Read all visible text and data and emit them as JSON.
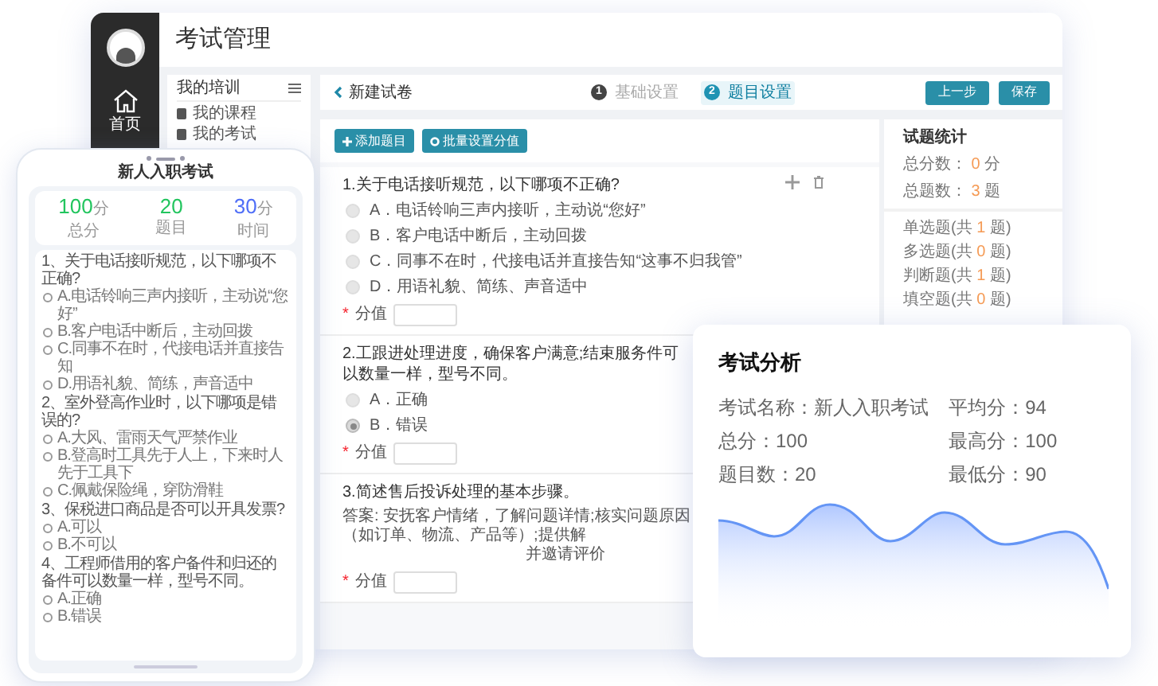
{
  "admin": {
    "title": "考试管理",
    "nav": [
      {
        "label": "首页",
        "selected": true
      }
    ],
    "sub_sidebar": {
      "title": "我的培训",
      "items": [
        {
          "label": "我的课程"
        },
        {
          "label": "我的考试"
        }
      ]
    },
    "topbar": {
      "back": "新建试卷",
      "steps": [
        {
          "number": "1",
          "label": "基础设置",
          "selected": false
        },
        {
          "number": "2",
          "label": "题目设置",
          "selected": true
        }
      ],
      "buttons": [
        "上一步",
        "保存"
      ]
    },
    "actions": [
      "添加题目",
      "批量设置分值"
    ],
    "questions": [
      {
        "kind": "choice",
        "title": "1.关于电话接听规范，以下哪项不正确?",
        "tools": true,
        "options": [
          {
            "label": "A．电话铃响三声内接听，主动说“您好”",
            "selected": false
          },
          {
            "label": "B．客户电话中断后，主动回拨",
            "selected": false
          },
          {
            "label": "C．同事不在时，代接电话并直接告知“这事不归我管”",
            "selected": false
          },
          {
            "label": "D．用语礼貌、简练、声音适中",
            "selected": false
          }
        ],
        "required": "*",
        "score_label": "分值"
      },
      {
        "kind": "choice",
        "title": "2.工跟进处理进度，确保客户满意;结束服务件可以数量一样，型号不同。",
        "options": [
          {
            "label": "A．正确",
            "selected": false
          },
          {
            "label": "B．错误",
            "selected": true
          }
        ],
        "required": "*",
        "score_label": "分值"
      },
      {
        "kind": "answer",
        "title": "3.简述售后投诉处理的基本步骤。",
        "answer": "答案: 安抚客户情绪，了解问题详情;核实问题原因（如订单、物流、产品等）;提供解",
        "answer_tail": "并邀请评价",
        "required": "*",
        "score_label": "分值"
      }
    ],
    "stats": {
      "title": "试题统计",
      "totals": [
        {
          "label": "总分数：",
          "value": "0",
          "unit": "分"
        },
        {
          "label": "总题数：",
          "value": "3",
          "unit": "题"
        }
      ],
      "types": [
        {
          "label": "单选题(共",
          "value": "1",
          "unit": "题)"
        },
        {
          "label": "多选题(共",
          "value": "0",
          "unit": "题)"
        },
        {
          "label": "判断题(共",
          "value": "1",
          "unit": "题)"
        },
        {
          "label": "填空题(共",
          "value": "0",
          "unit": "题)"
        }
      ]
    }
  },
  "phone": {
    "title": "新人入职考试",
    "stats": [
      {
        "value": "100",
        "unit": "分",
        "label": "总分",
        "color": "#22c55e"
      },
      {
        "value": "20",
        "label": "题目",
        "color": "#22c55e"
      },
      {
        "value": "30",
        "unit": "分",
        "label": "时间",
        "color": "#4f6ef7"
      }
    ],
    "questions": [
      {
        "title": "1、关于电话接听规范，以下哪项不正确?",
        "options": [
          "A.电话铃响三声内接听，主动说“您好”",
          "B.客户电话中断后，主动回拨",
          "C.同事不在时，代接电话并直接告知",
          "D.用语礼貌、简练，声音适中"
        ]
      },
      {
        "title": "2、室外登高作业时，以下哪项是错误的?",
        "options": [
          "A.大风、雷雨天气严禁作业",
          "B.登高时工具先于人上，下来时人先于工具下",
          "C.佩戴保险绳，穿防滑鞋"
        ]
      },
      {
        "title": "3、保税进口商品是否可以开具发票?",
        "options": [
          "A.可以",
          "B.不可以"
        ]
      },
      {
        "title": "4、工程师借用的客户备件和归还的备件可以数量一样，型号不同。",
        "options": [
          "A.正确",
          "B.错误"
        ]
      }
    ]
  },
  "analysis": {
    "title": "考试分析",
    "left": [
      "考试名称：新人入职考试",
      "总分：100",
      "题目数：20"
    ],
    "right": [
      "平均分：94",
      "最高分：100",
      "最低分：90"
    ]
  }
}
